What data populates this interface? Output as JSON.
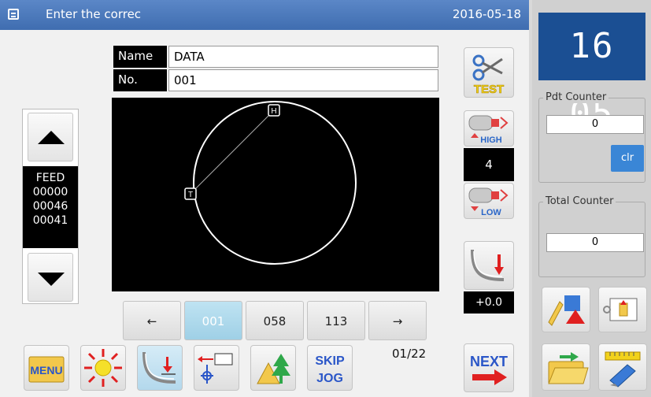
{
  "title_bar": {
    "message": "Enter the correc",
    "date": "2016-05-18"
  },
  "pattern": {
    "name_label": "Name",
    "name_value": "DATA",
    "no_label": "No.",
    "no_value": "001"
  },
  "feed": {
    "label": "FEED",
    "values": [
      "00000",
      "00046",
      "00041"
    ]
  },
  "canvas": {
    "start_marker": "T",
    "home_marker": "H"
  },
  "speed": {
    "high_label": "HIGH",
    "value": "4",
    "low_label": "LOW"
  },
  "test_button": {
    "label": "TEST"
  },
  "offset": {
    "value": "+0.0"
  },
  "page_nav": {
    "prev": "←",
    "items": [
      "001",
      "058",
      "113"
    ],
    "selected_index": 0,
    "next": "→",
    "page_indicator": "01/22"
  },
  "bottom_toolbar": {
    "menu_label": "MENU",
    "skip_label": "SKIP",
    "jog_label": "JOG",
    "next_label": "NEXT"
  },
  "clock": {
    "time": "16 05"
  },
  "counters": {
    "pdt": {
      "label": "Pdt Counter",
      "value": "0",
      "clear_label": "clr"
    },
    "total": {
      "label": "Total Counter",
      "value": "0"
    }
  },
  "colors": {
    "title_bar": "#4a78bb",
    "clock_bg": "#1b4f93",
    "selected_page": "#a9d8ec",
    "clear_button": "#3a86d6"
  }
}
